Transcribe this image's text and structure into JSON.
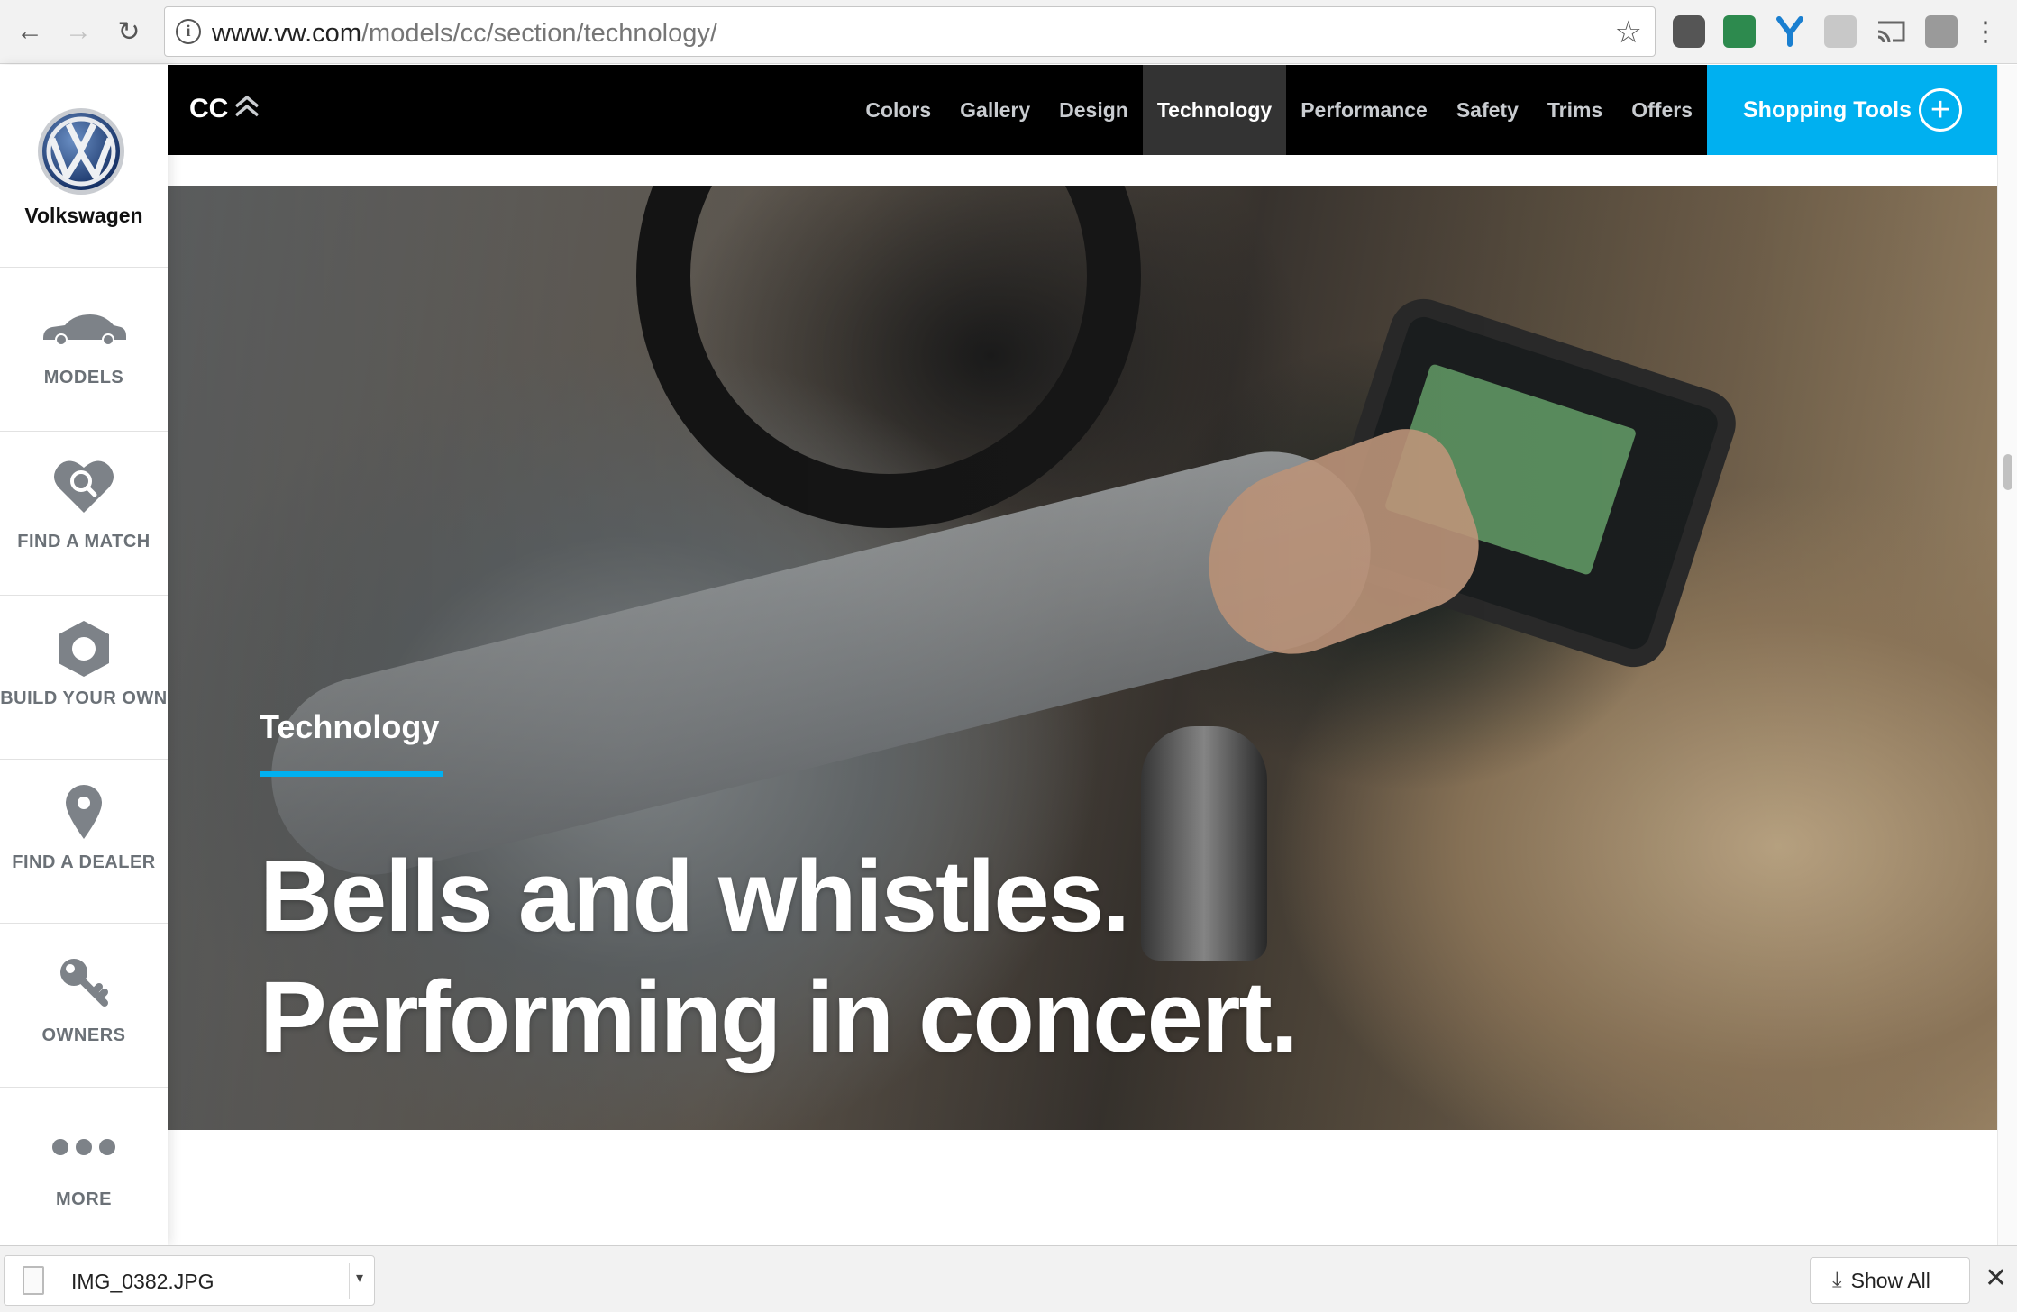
{
  "browser": {
    "url_host": "www.vw.com",
    "url_path": "/models/cc/section/technology/",
    "back_icon": "←",
    "forward_icon": "→",
    "reload_icon": "↻",
    "info_icon": "i",
    "star_icon": "☆",
    "menu_icon": "⋮"
  },
  "sidebar": {
    "brand_name": "Volkswagen",
    "items": [
      {
        "label": "MODELS",
        "icon": "car-icon"
      },
      {
        "label": "FIND A MATCH",
        "icon": "heart-search-icon"
      },
      {
        "label": "BUILD YOUR OWN",
        "icon": "hexagon-icon"
      },
      {
        "label": "FIND A DEALER",
        "icon": "map-pin-icon"
      },
      {
        "label": "OWNERS",
        "icon": "key-icon"
      },
      {
        "label": "MORE",
        "icon": "more-dots-icon"
      }
    ]
  },
  "topnav": {
    "model": "CC",
    "links": [
      "Colors",
      "Gallery",
      "Design",
      "Technology",
      "Performance",
      "Safety",
      "Trims",
      "Offers"
    ],
    "active": "Technology",
    "shopping_tools": "Shopping Tools",
    "plus_icon": "+"
  },
  "hero": {
    "section_label": "Technology",
    "headline_line1": "Bells and whistles.",
    "headline_line2": "Performing in concert."
  },
  "downloads": {
    "file_name": "IMG_0382.JPG",
    "dropdown_icon": "▾",
    "show_all": "Show All",
    "download_icon": "⤓",
    "close_icon": "✕"
  },
  "colors": {
    "accent": "#00b0f0",
    "nav_bg": "#000000",
    "nav_active_bg": "#333333",
    "sidebar_text": "#6b7177"
  }
}
